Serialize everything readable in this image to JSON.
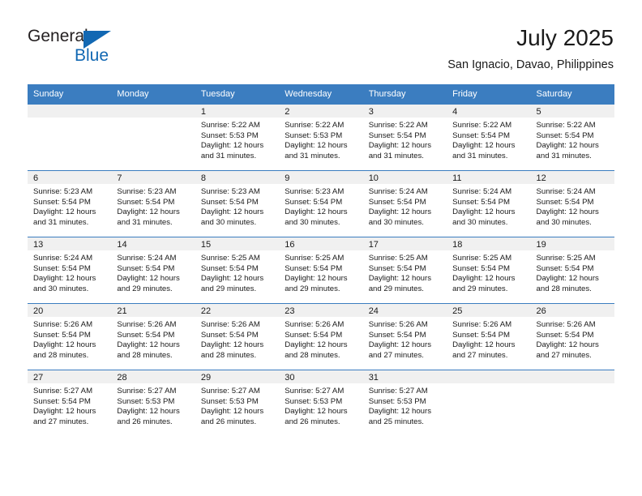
{
  "brand": {
    "name_part1": "General",
    "name_part2": "Blue",
    "triangle_color": "#1268b3"
  },
  "header": {
    "title": "July 2025",
    "subtitle": "San Ignacio, Davao, Philippines"
  },
  "theme": {
    "header_blue": "#3b7dc0",
    "daynum_band": "#f0f0f0",
    "text": "#1a1a1a"
  },
  "weekday_headers": [
    "Sunday",
    "Monday",
    "Tuesday",
    "Wednesday",
    "Thursday",
    "Friday",
    "Saturday"
  ],
  "weeks": [
    [
      {
        "day": "",
        "sunrise": "",
        "sunset": "",
        "daylight": ""
      },
      {
        "day": "",
        "sunrise": "",
        "sunset": "",
        "daylight": ""
      },
      {
        "day": "1",
        "sunrise": "Sunrise: 5:22 AM",
        "sunset": "Sunset: 5:53 PM",
        "daylight": "Daylight: 12 hours and 31 minutes."
      },
      {
        "day": "2",
        "sunrise": "Sunrise: 5:22 AM",
        "sunset": "Sunset: 5:53 PM",
        "daylight": "Daylight: 12 hours and 31 minutes."
      },
      {
        "day": "3",
        "sunrise": "Sunrise: 5:22 AM",
        "sunset": "Sunset: 5:54 PM",
        "daylight": "Daylight: 12 hours and 31 minutes."
      },
      {
        "day": "4",
        "sunrise": "Sunrise: 5:22 AM",
        "sunset": "Sunset: 5:54 PM",
        "daylight": "Daylight: 12 hours and 31 minutes."
      },
      {
        "day": "5",
        "sunrise": "Sunrise: 5:22 AM",
        "sunset": "Sunset: 5:54 PM",
        "daylight": "Daylight: 12 hours and 31 minutes."
      }
    ],
    [
      {
        "day": "6",
        "sunrise": "Sunrise: 5:23 AM",
        "sunset": "Sunset: 5:54 PM",
        "daylight": "Daylight: 12 hours and 31 minutes."
      },
      {
        "day": "7",
        "sunrise": "Sunrise: 5:23 AM",
        "sunset": "Sunset: 5:54 PM",
        "daylight": "Daylight: 12 hours and 31 minutes."
      },
      {
        "day": "8",
        "sunrise": "Sunrise: 5:23 AM",
        "sunset": "Sunset: 5:54 PM",
        "daylight": "Daylight: 12 hours and 30 minutes."
      },
      {
        "day": "9",
        "sunrise": "Sunrise: 5:23 AM",
        "sunset": "Sunset: 5:54 PM",
        "daylight": "Daylight: 12 hours and 30 minutes."
      },
      {
        "day": "10",
        "sunrise": "Sunrise: 5:24 AM",
        "sunset": "Sunset: 5:54 PM",
        "daylight": "Daylight: 12 hours and 30 minutes."
      },
      {
        "day": "11",
        "sunrise": "Sunrise: 5:24 AM",
        "sunset": "Sunset: 5:54 PM",
        "daylight": "Daylight: 12 hours and 30 minutes."
      },
      {
        "day": "12",
        "sunrise": "Sunrise: 5:24 AM",
        "sunset": "Sunset: 5:54 PM",
        "daylight": "Daylight: 12 hours and 30 minutes."
      }
    ],
    [
      {
        "day": "13",
        "sunrise": "Sunrise: 5:24 AM",
        "sunset": "Sunset: 5:54 PM",
        "daylight": "Daylight: 12 hours and 30 minutes."
      },
      {
        "day": "14",
        "sunrise": "Sunrise: 5:24 AM",
        "sunset": "Sunset: 5:54 PM",
        "daylight": "Daylight: 12 hours and 29 minutes."
      },
      {
        "day": "15",
        "sunrise": "Sunrise: 5:25 AM",
        "sunset": "Sunset: 5:54 PM",
        "daylight": "Daylight: 12 hours and 29 minutes."
      },
      {
        "day": "16",
        "sunrise": "Sunrise: 5:25 AM",
        "sunset": "Sunset: 5:54 PM",
        "daylight": "Daylight: 12 hours and 29 minutes."
      },
      {
        "day": "17",
        "sunrise": "Sunrise: 5:25 AM",
        "sunset": "Sunset: 5:54 PM",
        "daylight": "Daylight: 12 hours and 29 minutes."
      },
      {
        "day": "18",
        "sunrise": "Sunrise: 5:25 AM",
        "sunset": "Sunset: 5:54 PM",
        "daylight": "Daylight: 12 hours and 29 minutes."
      },
      {
        "day": "19",
        "sunrise": "Sunrise: 5:25 AM",
        "sunset": "Sunset: 5:54 PM",
        "daylight": "Daylight: 12 hours and 28 minutes."
      }
    ],
    [
      {
        "day": "20",
        "sunrise": "Sunrise: 5:26 AM",
        "sunset": "Sunset: 5:54 PM",
        "daylight": "Daylight: 12 hours and 28 minutes."
      },
      {
        "day": "21",
        "sunrise": "Sunrise: 5:26 AM",
        "sunset": "Sunset: 5:54 PM",
        "daylight": "Daylight: 12 hours and 28 minutes."
      },
      {
        "day": "22",
        "sunrise": "Sunrise: 5:26 AM",
        "sunset": "Sunset: 5:54 PM",
        "daylight": "Daylight: 12 hours and 28 minutes."
      },
      {
        "day": "23",
        "sunrise": "Sunrise: 5:26 AM",
        "sunset": "Sunset: 5:54 PM",
        "daylight": "Daylight: 12 hours and 28 minutes."
      },
      {
        "day": "24",
        "sunrise": "Sunrise: 5:26 AM",
        "sunset": "Sunset: 5:54 PM",
        "daylight": "Daylight: 12 hours and 27 minutes."
      },
      {
        "day": "25",
        "sunrise": "Sunrise: 5:26 AM",
        "sunset": "Sunset: 5:54 PM",
        "daylight": "Daylight: 12 hours and 27 minutes."
      },
      {
        "day": "26",
        "sunrise": "Sunrise: 5:26 AM",
        "sunset": "Sunset: 5:54 PM",
        "daylight": "Daylight: 12 hours and 27 minutes."
      }
    ],
    [
      {
        "day": "27",
        "sunrise": "Sunrise: 5:27 AM",
        "sunset": "Sunset: 5:54 PM",
        "daylight": "Daylight: 12 hours and 27 minutes."
      },
      {
        "day": "28",
        "sunrise": "Sunrise: 5:27 AM",
        "sunset": "Sunset: 5:53 PM",
        "daylight": "Daylight: 12 hours and 26 minutes."
      },
      {
        "day": "29",
        "sunrise": "Sunrise: 5:27 AM",
        "sunset": "Sunset: 5:53 PM",
        "daylight": "Daylight: 12 hours and 26 minutes."
      },
      {
        "day": "30",
        "sunrise": "Sunrise: 5:27 AM",
        "sunset": "Sunset: 5:53 PM",
        "daylight": "Daylight: 12 hours and 26 minutes."
      },
      {
        "day": "31",
        "sunrise": "Sunrise: 5:27 AM",
        "sunset": "Sunset: 5:53 PM",
        "daylight": "Daylight: 12 hours and 25 minutes."
      },
      {
        "day": "",
        "sunrise": "",
        "sunset": "",
        "daylight": ""
      },
      {
        "day": "",
        "sunrise": "",
        "sunset": "",
        "daylight": ""
      }
    ]
  ]
}
